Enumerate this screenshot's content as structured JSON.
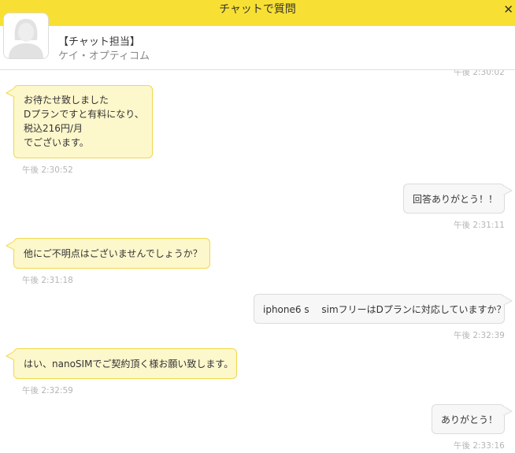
{
  "titlebar": {
    "title": "チャットで質問",
    "close_glyph": "✕"
  },
  "agent": {
    "name": "【チャット担当】",
    "company": "ケイ・オプティコム"
  },
  "messages": [
    {
      "side": "agent",
      "text": "お待たせ致しました\nDプランですと有料になり、\n税込216円/月\nでございます。",
      "time": "午後 2:30:52"
    },
    {
      "side": "user",
      "text": "回答ありがとう！！",
      "time": "午後 2:31:11"
    },
    {
      "side": "agent",
      "text": "他にご不明点はございませんでしょうか？",
      "time": "午後 2:31:18"
    },
    {
      "side": "user",
      "text": "iphone6 s　 simフリーはDプランに対応していますか？",
      "time": "午後 2:32:39"
    },
    {
      "side": "agent",
      "text": "はい、nanoSIMでご契約頂く様お願い致します。",
      "time": "午後 2:32:59"
    },
    {
      "side": "user",
      "text": "ありがとう！",
      "time": "午後 2:33:16"
    }
  ],
  "top_timestamp": "午後 2:30:02",
  "colors": {
    "header": "#f7e033",
    "agent_bubble": "#fdf7cc",
    "agent_border": "#f0d94a",
    "user_bubble": "#f7f7f7"
  }
}
